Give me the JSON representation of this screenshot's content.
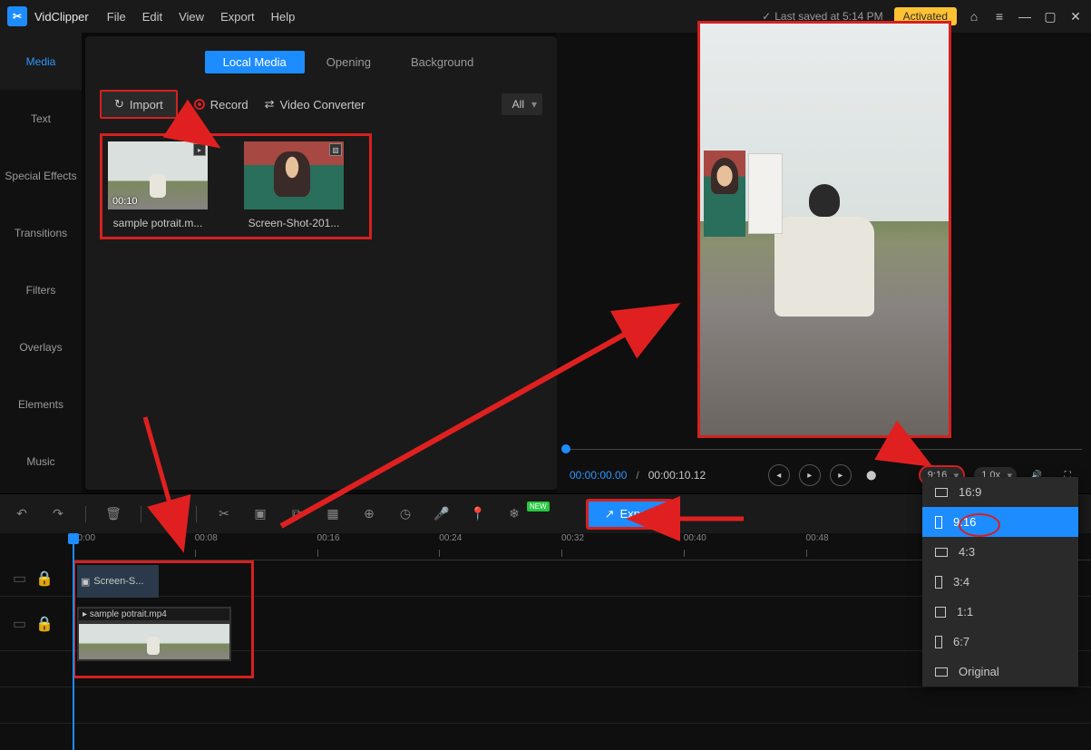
{
  "app_name": "VidClipper",
  "menu": [
    "File",
    "Edit",
    "View",
    "Export",
    "Help"
  ],
  "saved_text": "Last saved at 5:14 PM",
  "activated": "Activated",
  "sidebar": [
    "Media",
    "Text",
    "Special Effects",
    "Transitions",
    "Filters",
    "Overlays",
    "Elements",
    "Music"
  ],
  "media_tabs": [
    "Local Media",
    "Opening",
    "Background"
  ],
  "import_label": "Import",
  "record_label": "Record",
  "converter_label": "Video Converter",
  "filter_all": "All",
  "clips": [
    {
      "name": "sample potrait.m...",
      "duration": "00:10"
    },
    {
      "name": "Screen-Shot-201..."
    }
  ],
  "time": {
    "current": "00:00:00.00",
    "total": "00:00:10.12"
  },
  "ratio_selected": "9:16",
  "speed": "1.0x",
  "export_label": "Export",
  "ruler_ticks": [
    "00:00",
    "00:08",
    "00:16",
    "00:24",
    "00:32",
    "00:40",
    "00:48"
  ],
  "tl_clips": [
    {
      "name": "Screen-S..."
    },
    {
      "name": "sample potrait.mp4"
    }
  ],
  "ratio_options": [
    "16:9",
    "9:16",
    "4:3",
    "3:4",
    "1:1",
    "6:7",
    "Original"
  ],
  "new_badge": "NEW"
}
